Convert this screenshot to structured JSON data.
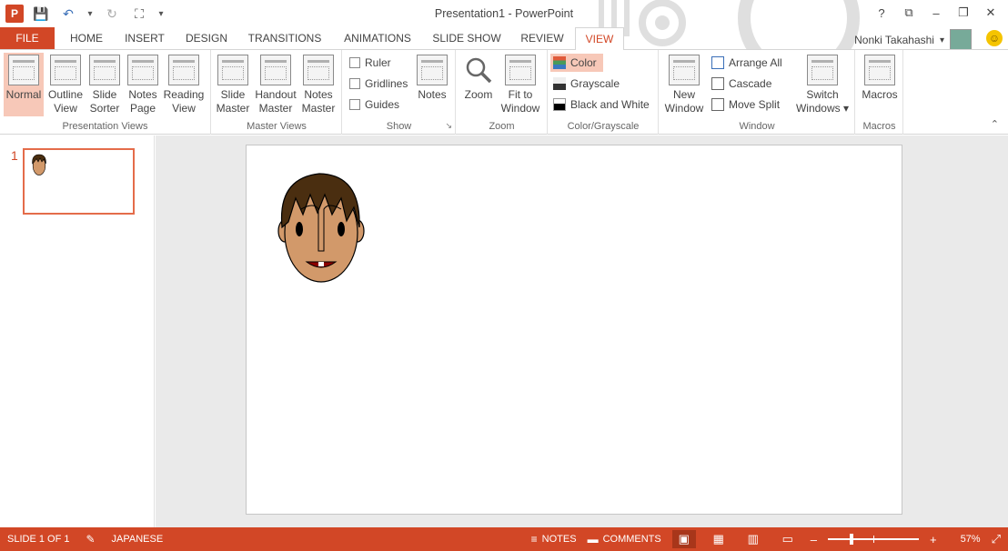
{
  "title": "Presentation1 - PowerPoint",
  "window_controls": {
    "help": "?",
    "ribbon_options": "⧉",
    "minimize": "–",
    "restore": "❐",
    "close": "✕"
  },
  "qat": {
    "app_icon": "P",
    "save": "💾",
    "undo": "↶",
    "undo_dropdown": "▾",
    "redo": "↻",
    "present": "⛶",
    "customize": "▾"
  },
  "tabs": [
    "FILE",
    "HOME",
    "INSERT",
    "DESIGN",
    "TRANSITIONS",
    "ANIMATIONS",
    "SLIDE SHOW",
    "REVIEW",
    "VIEW"
  ],
  "user": {
    "name": "Nonki Takahashi",
    "dropdown": "▾",
    "smiley": "☺"
  },
  "ribbon": {
    "presentation_views": {
      "label": "Presentation Views",
      "normal": "Normal",
      "outline": [
        "Outline",
        "View"
      ],
      "sorter": [
        "Slide",
        "Sorter"
      ],
      "notes_page": [
        "Notes",
        "Page"
      ],
      "reading": [
        "Reading",
        "View"
      ]
    },
    "master_views": {
      "label": "Master Views",
      "slide": [
        "Slide",
        "Master"
      ],
      "handout": [
        "Handout",
        "Master"
      ],
      "notes": [
        "Notes",
        "Master"
      ]
    },
    "show": {
      "label": "Show",
      "ruler": "Ruler",
      "gridlines": "Gridlines",
      "guides": "Guides",
      "notes": "Notes",
      "launcher": "↘"
    },
    "zoom": {
      "label": "Zoom",
      "zoom": "Zoom",
      "fit": [
        "Fit to",
        "Window"
      ]
    },
    "color": {
      "label": "Color/Grayscale",
      "color": "Color",
      "grayscale": "Grayscale",
      "bw": "Black and White"
    },
    "window": {
      "label": "Window",
      "new": [
        "New",
        "Window"
      ],
      "arrange": "Arrange All",
      "cascade": "Cascade",
      "split": "Move Split",
      "switch": [
        "Switch",
        "Windows ▾"
      ]
    },
    "macros": {
      "label": "Macros",
      "macros": "Macros"
    },
    "collapse": "⌃"
  },
  "thumbnails": [
    {
      "number": "1"
    }
  ],
  "status": {
    "slide": "SLIDE 1 OF 1",
    "language": "JAPANESE",
    "notes": "NOTES",
    "comments": "COMMENTS",
    "zoom_minus": "–",
    "zoom_plus": "+",
    "zoom": "57%",
    "zoom_fraction": 0.57,
    "fit_icon": "⤢"
  },
  "colors": {
    "accent": "#d24726",
    "skin": "#d2996a",
    "hair": "#4a2e10"
  }
}
